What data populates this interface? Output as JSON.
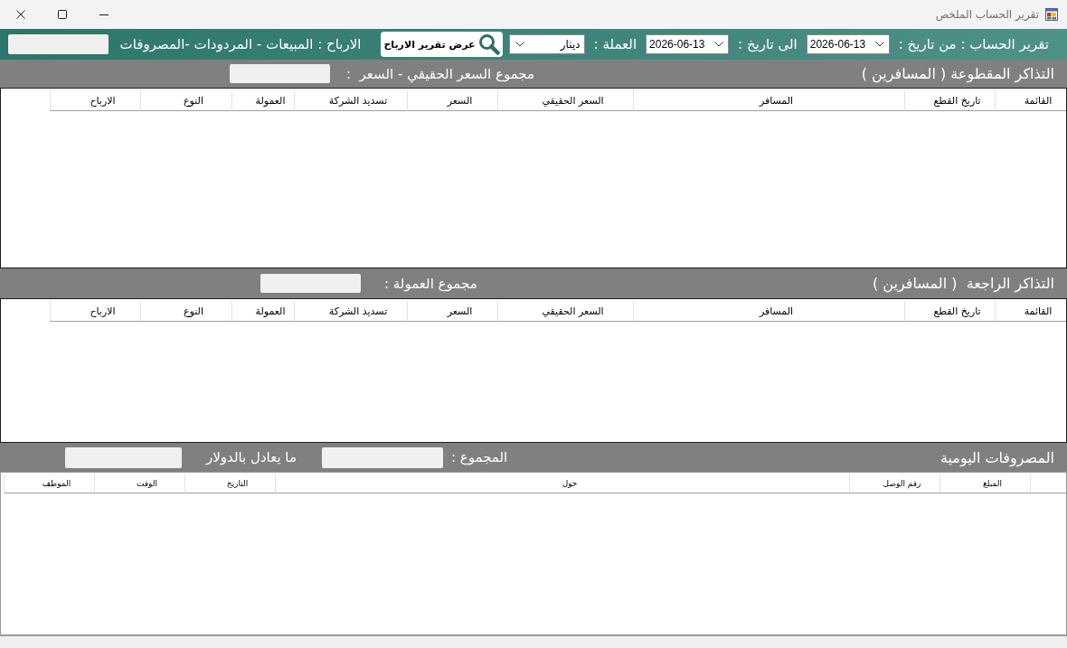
{
  "window": {
    "title": "تقرير الحساب الملخص"
  },
  "toolbar": {
    "from_label": "تقرير الحساب : من تاريخ :",
    "from_date": "2026-06-13",
    "to_label": "الى تاريخ :",
    "to_date": "2026-06-13",
    "currency_label": "العملة :",
    "currency": "دينار",
    "show_button": "عرض تقرير الارباح",
    "profit_label": "الارباح : المبيعات - المردودات -المصروفات"
  },
  "sections": [
    {
      "kind": "tickets",
      "title": "التذاكر المقطوعة ( المسافرين )",
      "totals": [
        {
          "label": "مجموع السعر الحقيقي - السعر  :"
        }
      ],
      "columns": [
        "القائمة",
        "تاريخ القطع",
        "المسافر",
        "السعر الحقيقي",
        "السعر",
        "تسديد الشركة",
        "العمولة",
        "النوع",
        "الارباح"
      ]
    },
    {
      "kind": "tickets",
      "title": "التذاكر الراجعة  ( المسافرين )",
      "totals": [
        {
          "label": "مجموع العمولة :"
        }
      ],
      "columns": [
        "القائمة",
        "تاريخ القطع",
        "المسافر",
        "السعر الحقيقي",
        "السعر",
        "تسديد الشركة",
        "العمولة",
        "النوع",
        "الارباح"
      ]
    },
    {
      "kind": "expenses",
      "title": "المصروفات اليومية",
      "totals": [
        {
          "label": "المجموع :"
        },
        {
          "label": "ما يعادل بالدولار"
        }
      ],
      "columns": [
        "المبلغ",
        "رقم الوصل",
        "حول",
        "التاريخ",
        "الوقت",
        "الموظف"
      ]
    }
  ]
}
